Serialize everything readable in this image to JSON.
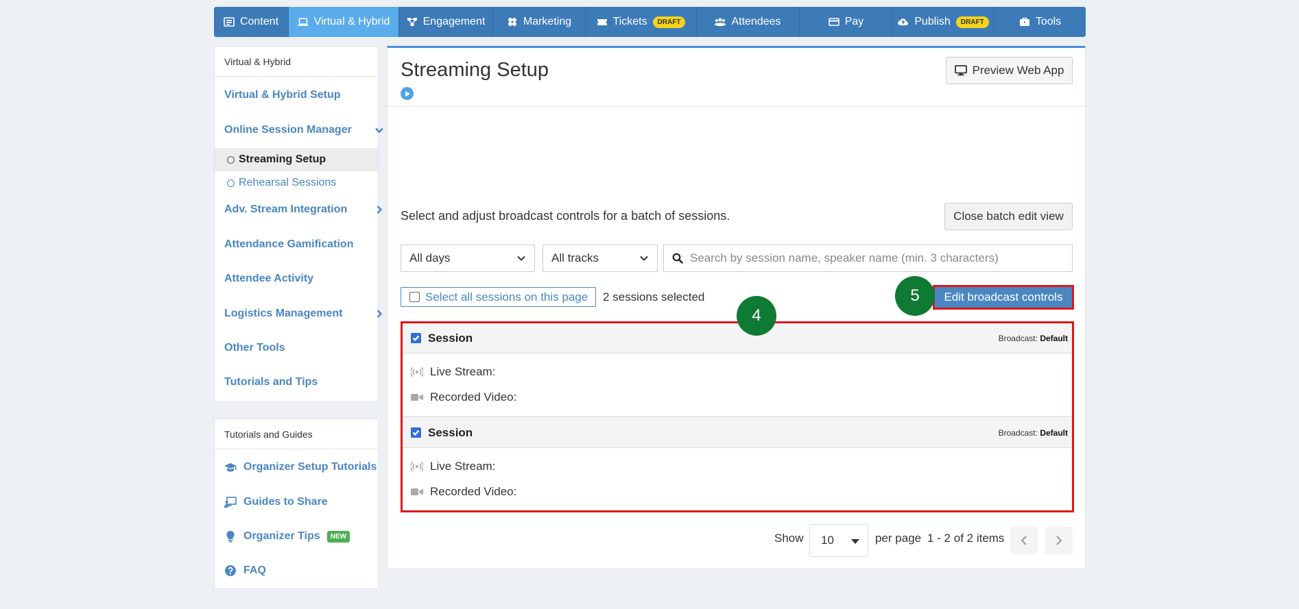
{
  "topnav": {
    "tabs": [
      {
        "label": "Content",
        "icon": "content-icon"
      },
      {
        "label": "Virtual & Hybrid",
        "icon": "laptop-icon",
        "active": true
      },
      {
        "label": "Engagement",
        "icon": "engagement-icon"
      },
      {
        "label": "Marketing",
        "icon": "marketing-icon"
      },
      {
        "label": "Tickets",
        "icon": "ticket-icon",
        "badge": "DRAFT"
      },
      {
        "label": "Attendees",
        "icon": "attendees-icon"
      },
      {
        "label": "Pay",
        "icon": "credit-card-icon"
      },
      {
        "label": "Publish",
        "icon": "cloud-upload-icon",
        "badge": "DRAFT"
      },
      {
        "label": "Tools",
        "icon": "toolbox-icon"
      }
    ]
  },
  "sidebar": {
    "heading": "Virtual & Hybrid",
    "items": [
      {
        "label": "Virtual & Hybrid Setup"
      },
      {
        "label": "Online Session Manager"
      },
      {
        "label": "Streaming Setup"
      },
      {
        "label": "Rehearsal Sessions"
      },
      {
        "label": "Adv. Stream Integration"
      },
      {
        "label": "Attendance Gamification"
      },
      {
        "label": "Attendee Activity"
      },
      {
        "label": "Logistics Management"
      },
      {
        "label": "Other Tools"
      },
      {
        "label": "Tutorials and Tips"
      }
    ]
  },
  "guides": {
    "heading": "Tutorials and Guides",
    "items": [
      {
        "label": "Organizer Setup Tutorials",
        "icon": "graduation-cap-icon"
      },
      {
        "label": "Guides to Share",
        "icon": "presentation-icon"
      },
      {
        "label": "Organizer Tips",
        "icon": "lightbulb-icon",
        "badge": "NEW"
      },
      {
        "label": "FAQ",
        "icon": "question-circle-icon"
      }
    ]
  },
  "main": {
    "title": "Streaming Setup",
    "preview_button": "Preview Web App",
    "description": "Select and adjust broadcast controls for a batch of sessions.",
    "close_batch_button": "Close batch edit view",
    "filters": {
      "days": "All days",
      "tracks": "All tracks",
      "search_placeholder": "Search by session name, speaker name (min. 3 characters)"
    },
    "select_all_label": "Select all sessions on this page",
    "selected_count": "2 sessions selected",
    "edit_broadcast_button": "Edit broadcast controls",
    "step_markers": [
      "4",
      "5"
    ],
    "sessions": [
      {
        "title": "Session",
        "broadcast_label": "Broadcast:",
        "broadcast_value": "Default",
        "live_stream": "Live Stream:",
        "recorded_video": "Recorded Video:",
        "checked": true
      },
      {
        "title": "Session",
        "broadcast_label": "Broadcast:",
        "broadcast_value": "Default",
        "live_stream": "Live Stream:",
        "recorded_video": "Recorded Video:",
        "checked": true
      }
    ],
    "pagination": {
      "show_label": "Show",
      "per_page_value": "10",
      "per_page_label": "per page",
      "items_label": "1 - 2 of 2 items"
    }
  },
  "colors": {
    "nav_bg": "#3d7ab8",
    "nav_active": "#5aacea",
    "link": "#4a86c0",
    "highlight_red": "#e0151b",
    "step_green": "#0f7a33",
    "draft_badge": "#f5d31a",
    "new_badge": "#4caf50"
  }
}
